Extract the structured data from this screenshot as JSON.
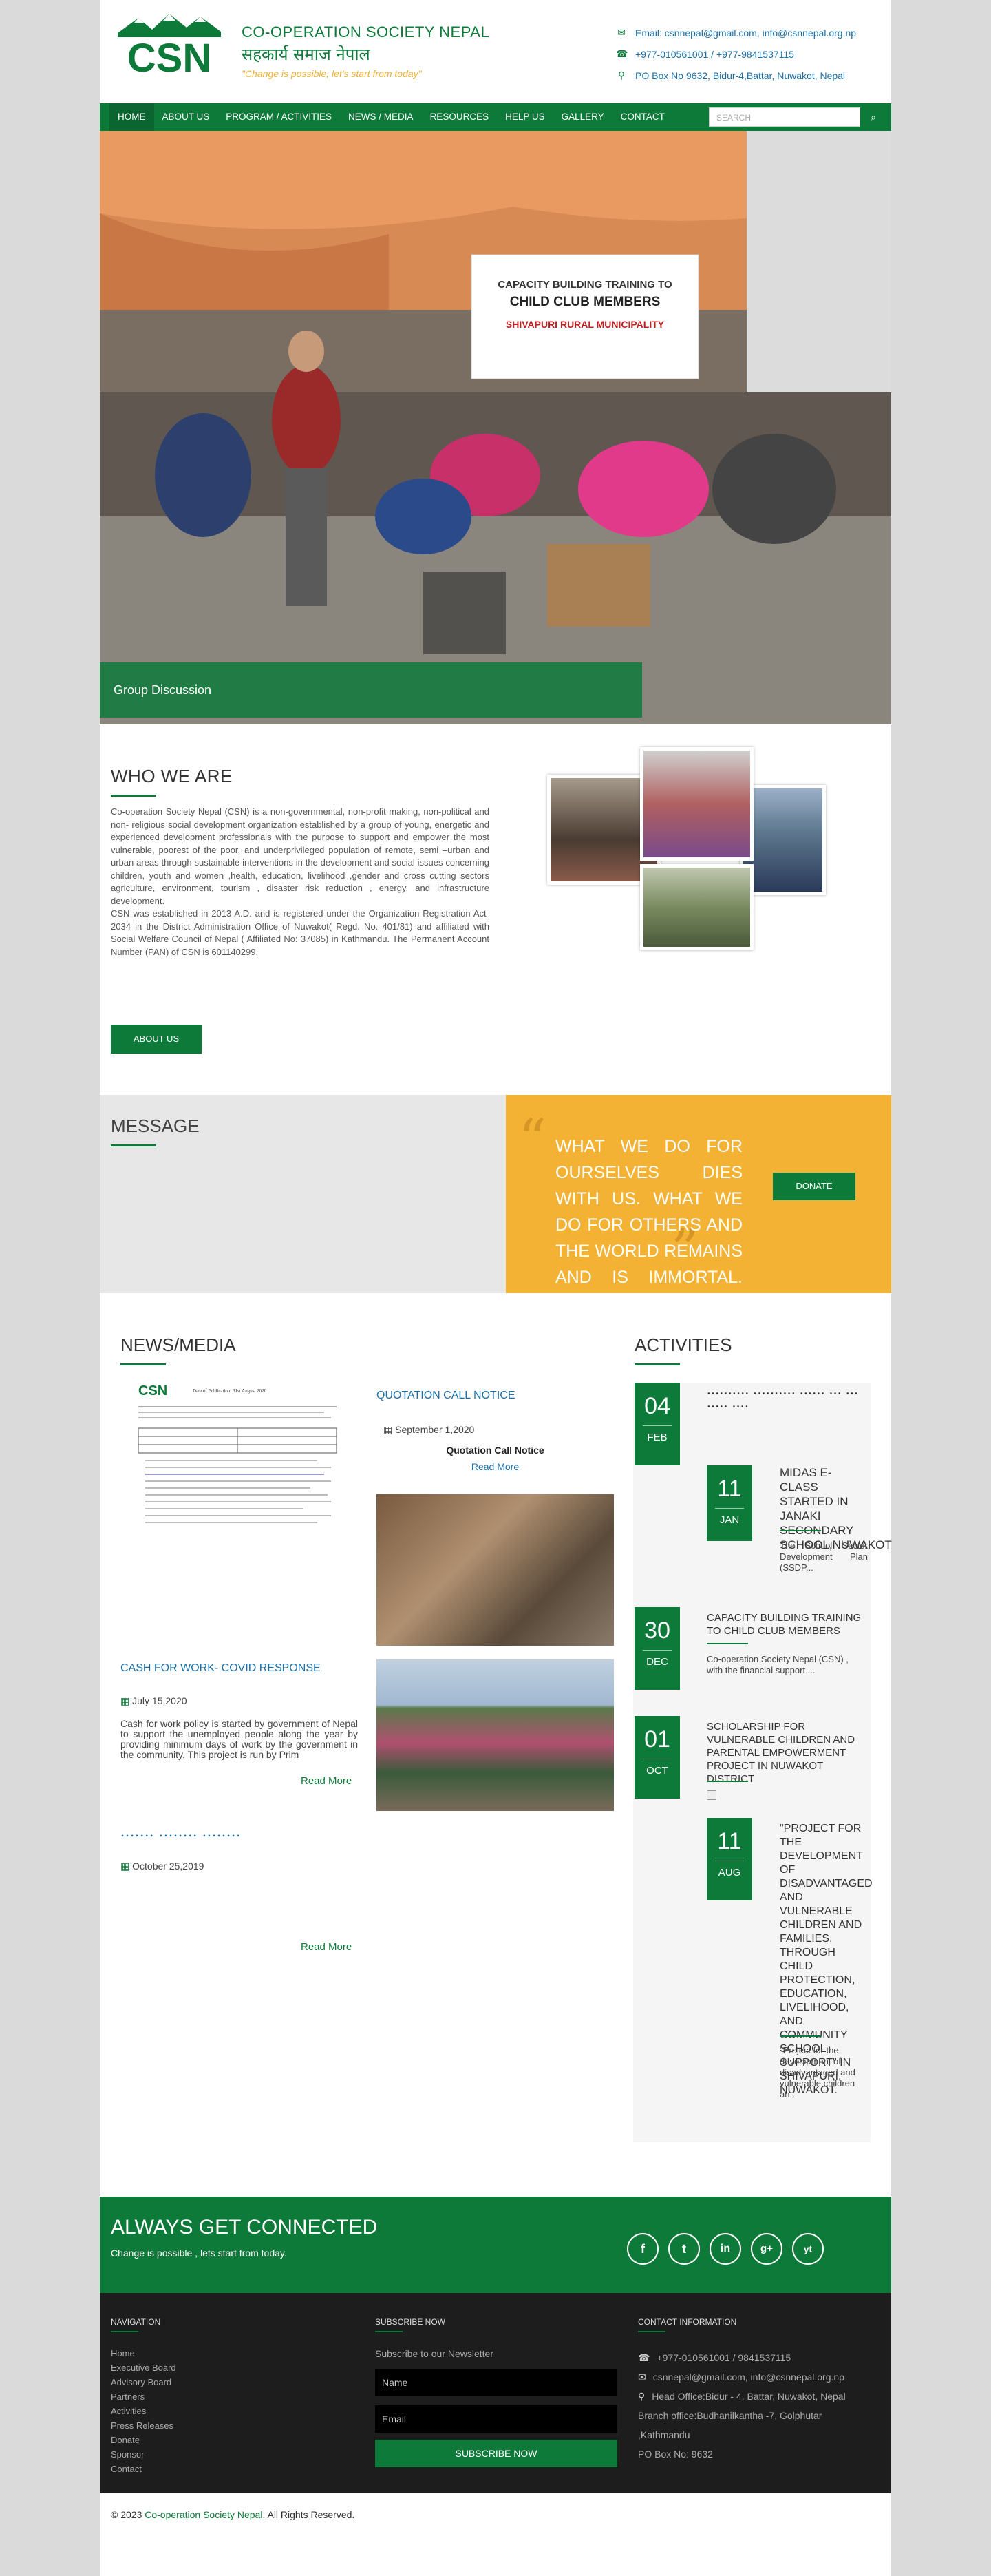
{
  "header": {
    "logo_abbr": "CSN",
    "org_name_en": "CO-OPERATION SOCIETY NEPAL",
    "org_name_np": "सहकार्य समाज नेपाल",
    "tagline": "\"Change is possible, let's start from today\"",
    "email": "Email: csnnepal@gmail.com, info@csnnepal.org.np",
    "phone": "+977-010561001 / +977-9841537115",
    "address": "PO Box No 9632, Bidur-4,Battar, Nuwakot, Nepal"
  },
  "nav": {
    "items": [
      "HOME",
      "ABOUT US",
      "PROGRAM / ACTIVITIES",
      "NEWS / MEDIA",
      "RESOURCES",
      "HELP US",
      "GALLERY",
      "CONTACT"
    ],
    "search_placeholder": "SEARCH"
  },
  "hero": {
    "caption": "Group Discussion",
    "banner_line1": "CAPACITY BUILDING TRAINING TO",
    "banner_line2": "CHILD CLUB MEMBERS",
    "banner_line3": "SHIVAPURI RURAL MUNICIPALITY"
  },
  "who": {
    "title": "WHO WE ARE",
    "paragraph1": "Co-operation Society Nepal (CSN) is a non-governmental, non-profit making, non-political and non- religious social development organization established by a group of young, energetic and experienced development professionals with the purpose to support and empower the most vulnerable, poorest of the poor, and underprivileged population of remote, semi –urban and urban areas through sustainable interventions in the development and social issues concerning children, youth and women ,health, education, livelihood ,gender and cross cutting sectors agriculture, environment, tourism , disaster risk reduction , energy, and infrastructure development.",
    "paragraph2": "CSN was established in 2013 A.D. and is registered under the Organization Registration Act- 2034 in the District Administration Office of Nuwakot( Regd. No. 401/81) and affiliated with Social Welfare Council of Nepal ( Affiliated No: 37085) in Kathmandu. The Permanent Account Number (PAN) of CSN is 601140299.",
    "button": "ABOUT US"
  },
  "message": {
    "title": "MESSAGE",
    "quote": "WHAT WE DO FOR OURSELVES DIES WITH US. WHAT WE DO FOR OTHERS AND THE WORLD REMAINS AND IS IMMORTAL.",
    "donate": "DONATE"
  },
  "news": {
    "title": "NEWS/MEDIA",
    "items": [
      {
        "title": "CASH FOR WORK- COVID RESPONSE",
        "date": "July 15,2020",
        "body": "Cash for work policy is started by government of Nepal to support the unemployed people along the year by providing minimum days of work by the government in the community. This project is run by Prim",
        "more": "Read More"
      },
      {
        "title": "𑁦𑁦𑁦𑁦𑁦𑁦𑁦 𑁦𑁦𑁦𑁦𑁦𑁦𑁦𑁦 𑁦𑁦𑁦𑁦𑁦𑁦𑁦𑁦",
        "date": "October 25,2019",
        "more": "Read More"
      },
      {
        "title": "QUOTATION CALL NOTICE",
        "date": "September 1,2020",
        "body": "Quotation Call Notice",
        "more": "Read More"
      }
    ],
    "doc_title": "Date of Publication: 31st August 2020"
  },
  "activities": {
    "title": "ACTIVITIES",
    "items": [
      {
        "day": "04",
        "month": "FEB",
        "title": "𑁦𑁦𑁦𑁦𑁦𑁦𑁦𑁦𑁦𑁦 𑁦𑁦𑁦𑁦𑁦𑁦𑁦𑁦𑁦𑁦 𑁦𑁦𑁦𑁦𑁦𑁦 𑁦𑁦𑁦 𑁦𑁦𑁦𑁦𑁦𑁦𑁦𑁦 𑁦𑁦𑁦𑁦"
      },
      {
        "day": "11",
        "month": "JAN",
        "title": "MIDAS E-CLASS STARTED IN JANAKI SECONDARY SCHOOL,NUWAKOT",
        "text": "The School Sector Development Plan (SSDP..."
      },
      {
        "day": "30",
        "month": "DEC",
        "title": "CAPACITY BUILDING TRAINING TO CHILD CLUB MEMBERS",
        "text": "Co-operation Society Nepal (CSN) , with the financial support ..."
      },
      {
        "day": "01",
        "month": "OCT",
        "title": "SCHOLARSHIP FOR VULNERABLE CHILDREN AND PARENTAL EMPOWERMENT PROJECT IN NUWAKOT DISTRICT"
      },
      {
        "day": "11",
        "month": "AUG",
        "title": "\"PROJECT FOR THE DEVELOPMENT OF DISADVANTAGED AND VULNERABLE CHILDREN AND FAMILIES, THROUGH CHILD PROTECTION, EDUCATION, LIVELIHOOD, AND COMMUNITY SCHOOL SUPPORT\" IN SHIVAPURI, NUWAKOT.",
        "text": "\"Project for the development of disadvantaged and vulnerable children an..."
      }
    ]
  },
  "connected": {
    "title": "ALWAYS GET CONNECTED",
    "subtitle": "Change is possible , lets start from today.",
    "icons": [
      "f",
      "t",
      "in",
      "g+",
      "yt"
    ]
  },
  "footer": {
    "nav_title": "NAVIGATION",
    "links": [
      "Home",
      "Executive Board",
      "Advisory Board",
      "Partners",
      "Activities",
      "Press Releases",
      "Donate",
      "Sponsor",
      "Contact"
    ],
    "subscribe_title": "SUBSCRIBE NOW",
    "subscribe_text": "Subscribe to our Newsletter",
    "name_placeholder": "Name",
    "email_placeholder": "Email",
    "subscribe_button": "SUBSCRIBE NOW",
    "contact_title": "CONTACT INFORMATION",
    "contact_phone": "+977-010561001 / 9841537115",
    "contact_email": "csnnepal@gmail.com, info@csnnepal.org.np",
    "contact_head": "Head Office:Bidur - 4, Battar, Nuwakot, Nepal",
    "contact_branch1": "Branch office:Budhanilkantha -7, Golphutar",
    "contact_branch2": ",Kathmandu",
    "contact_pobox": "PO Box No: 9632"
  },
  "copyright": {
    "prefix": "© 2023 ",
    "brand": "Co-operation Society Nepal",
    "suffix": ". All Rights Reserved."
  },
  "colors": {
    "brand_green": "#0d7a3a",
    "accent_yellow": "#f3b233",
    "link_blue": "#1a6fa8"
  }
}
